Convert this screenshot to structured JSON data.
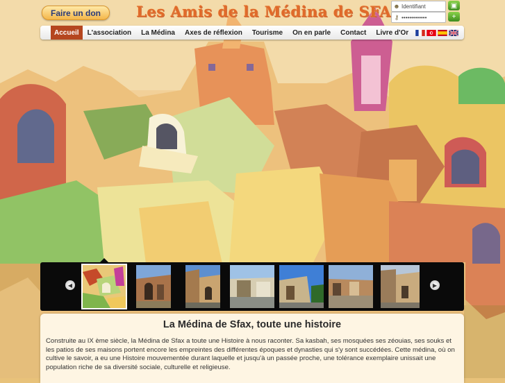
{
  "header": {
    "donate_label": "Faire un don",
    "site_title": "Les Amis de la Médina de SFAX"
  },
  "login": {
    "username_placeholder": "Identifiant",
    "password_value": "•••••••••••••"
  },
  "nav": {
    "items": [
      {
        "label": "Accueil",
        "active": true
      },
      {
        "label": "L'association"
      },
      {
        "label": "La Médina"
      },
      {
        "label": "Axes de réflexion"
      },
      {
        "label": "Tourisme"
      },
      {
        "label": "On en parle"
      },
      {
        "label": "Contact"
      },
      {
        "label": "Livre d'Or"
      }
    ],
    "languages": [
      "fr-flag",
      "tn-flag",
      "es-flag",
      "uk-flag"
    ]
  },
  "carousel": {
    "prev_icon": "arrow-left-icon",
    "next_icon": "arrow-right-icon",
    "thumbnail_count": 7,
    "selected_index": 0
  },
  "content": {
    "title": "La Médina de Sfax, toute une histoire",
    "body": "Construite au IX ème siècle, la Médina de Sfax a toute une Histoire à nous raconter. Sa kasbah, ses mosquées ses zéouias, ses souks et les patios de ses maisons portent encore les empreintes des différentes époques et dynasties qui s'y sont succédées. Cette médina, où on cultive le savoir, a eu une Histoire mouvementée durant laquelle et jusqu'à un passée proche, une tolérance exemplaire unissait une population riche de sa diversité sociale, culturelle et religieuse."
  },
  "colors": {
    "accent": "#b5461f",
    "title": "#e06a2a",
    "donate": "#f4b64a"
  }
}
